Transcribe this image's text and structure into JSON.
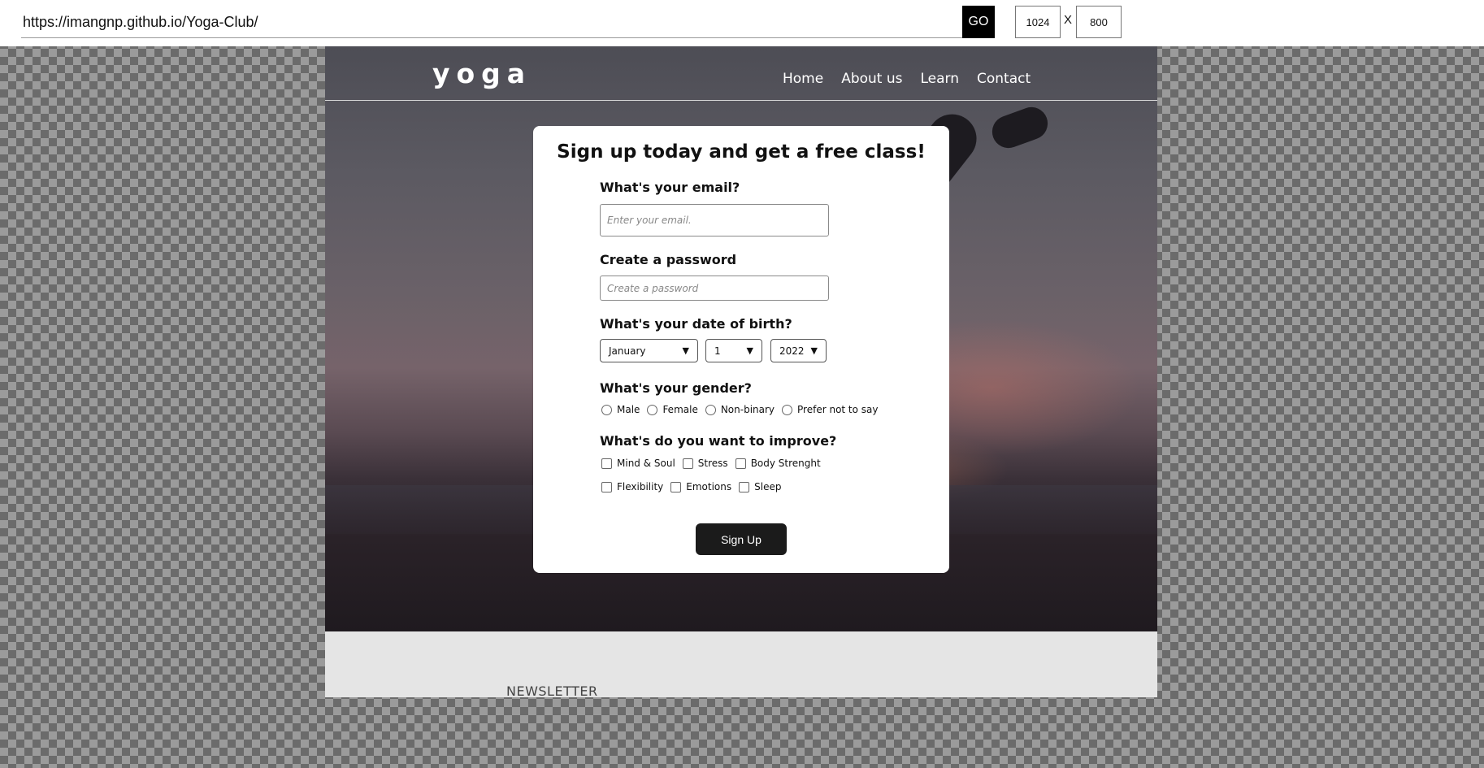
{
  "browser": {
    "url": "https://imangnp.github.io/Yoga-Club/",
    "go_label": "GO",
    "width": "1024",
    "separator": "X",
    "height": "800"
  },
  "site": {
    "logo": "yoga",
    "nav": [
      "Home",
      "About us",
      "Learn",
      "Contact"
    ]
  },
  "form": {
    "title": "Sign up today and get a free class!",
    "email_label": "What's your email?",
    "email_placeholder": "Enter your email.",
    "password_label": "Create a password",
    "password_placeholder": "Create a password",
    "dob_label": "What's your date of birth?",
    "dob_month": "January",
    "dob_day": "1",
    "dob_year": "2022",
    "gender_label": "What's your gender?",
    "gender_options": [
      "Male",
      "Female",
      "Non-binary",
      "Prefer not to say"
    ],
    "improve_label": "What's do you want to improve?",
    "improve_options_row1": [
      "Mind & Soul",
      "Stress",
      "Body Strenght"
    ],
    "improve_options_row2": [
      "Flexibility",
      "Emotions",
      "Sleep"
    ],
    "submit_label": "Sign Up"
  },
  "footer": {
    "newsletter_title": "NEWSLETTER"
  }
}
